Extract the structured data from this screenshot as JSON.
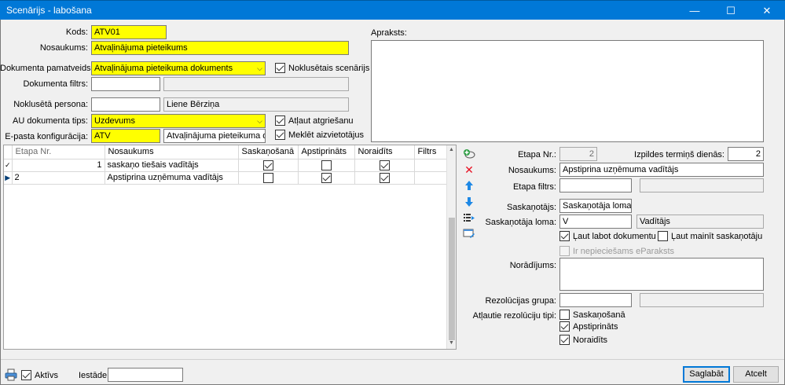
{
  "window": {
    "title": "Scenārijs - labošana",
    "minimize": "—",
    "maximize": "☐",
    "close": "✕"
  },
  "form": {
    "kods_label": "Kods:",
    "kods_value": "ATV01",
    "nosaukums_label": "Nosaukums:",
    "nosaukums_value": "Atvaļinājuma pieteikums",
    "dok_pamatveids_label": "Dokumenta pamatveids:",
    "dok_pamatveids_value": "Atvaļinājuma pieteikuma dokuments",
    "noklusetais_label": "Noklusētais scenārijs",
    "noklusetais_checked": true,
    "dok_filtrs_label": "Dokumenta filtrs:",
    "dok_filtrs_value": "",
    "dok_filtrs_desc": "",
    "nokl_persona_label": "Noklusētā persona:",
    "nokl_persona_value": "",
    "nokl_persona_name": "Liene Bērziņa",
    "au_tips_label": "AU dokumenta tips:",
    "au_tips_value": "Uzdevums",
    "atlaut_atgriesanu_label": "Atļaut atgriešanu",
    "atlaut_atgriesanu_checked": true,
    "epasta_label": "E-pasta konfigurācija:",
    "epasta_value": "ATV",
    "epasta_desc": "Atvaļinājuma pieteikuma dokumer",
    "meklet_label": "Meklēt aizvietotājus",
    "meklet_checked": true,
    "apraksts_label": "Apraksts:",
    "apraksts_value": ""
  },
  "grid": {
    "columns": [
      "Etapa Nr.",
      "Nosaukums",
      "Saskaņošanā",
      "Apstiprināts",
      "Noraidīts",
      "Filtrs"
    ],
    "rows": [
      {
        "indicator": "✓",
        "etapa": "1",
        "nosaukums": "saskaņo tiešais vadītājs",
        "saskanosana": true,
        "apstiprinats": false,
        "noraidits": true,
        "filtrs": ""
      },
      {
        "indicator": "▶",
        "etapa": "2",
        "nosaukums": "Apstiprina uzņēmuma vadītājs",
        "saskanosana": false,
        "apstiprinats": true,
        "noraidits": true,
        "filtrs": ""
      }
    ]
  },
  "toolbar": {
    "icons": [
      "add-icon",
      "delete-icon",
      "move-up-icon",
      "move-down-icon",
      "list-icon",
      "edit-icon"
    ]
  },
  "detail": {
    "etapa_nr_label": "Etapa Nr.:",
    "etapa_nr_value": "2",
    "izpildes_label": "Izpildes termiņš dienās:",
    "izpildes_value": "2",
    "nosaukums_label": "Nosaukums:",
    "nosaukums_value": "Apstiprina uzņēmuma vadītājs",
    "etapa_filtrs_label": "Etapa filtrs:",
    "etapa_filtrs_value": "",
    "etapa_filtrs_desc": "",
    "saskanotajs_label": "Saskaņotājs:",
    "saskanotajs_value": "Saskaņotāja loma",
    "saskanotaja_loma_label": "Saskaņotāja loma:",
    "saskanotaja_loma_value": "V",
    "saskanotaja_loma_name": "Vadītājs",
    "laut_labot_label": "Ļaut labot dokumentu",
    "laut_labot_checked": true,
    "laut_mainit_label": "Ļaut mainīt saskaņotāju",
    "laut_mainit_checked": false,
    "eparaksts_label": "Ir nepieciešams eParaksts",
    "eparaksts_checked": false,
    "noradijums_label": "Norādījums:",
    "noradijums_value": "",
    "rezolucijas_label": "Rezolūcijas grupa:",
    "rezolucijas_value": "",
    "rezolucijas_desc": "",
    "atlautie_label": "Atļautie rezolūciju tipi:",
    "tipi": [
      {
        "label": "Saskaņošanā",
        "checked": false
      },
      {
        "label": "Apstiprināts",
        "checked": true
      },
      {
        "label": "Noraidīts",
        "checked": true
      }
    ]
  },
  "footer": {
    "aktivs_label": "Aktīvs",
    "aktivs_checked": true,
    "iestade_label": "Iestāde:",
    "iestade_value": "",
    "save_label": "Saglabāt",
    "cancel_label": "Atcelt"
  },
  "colors": {
    "titlebar": "#0078d7",
    "required": "#ffff00",
    "delete": "#e81123",
    "arrow": "#1e88e5",
    "add": "#2e9e44"
  }
}
